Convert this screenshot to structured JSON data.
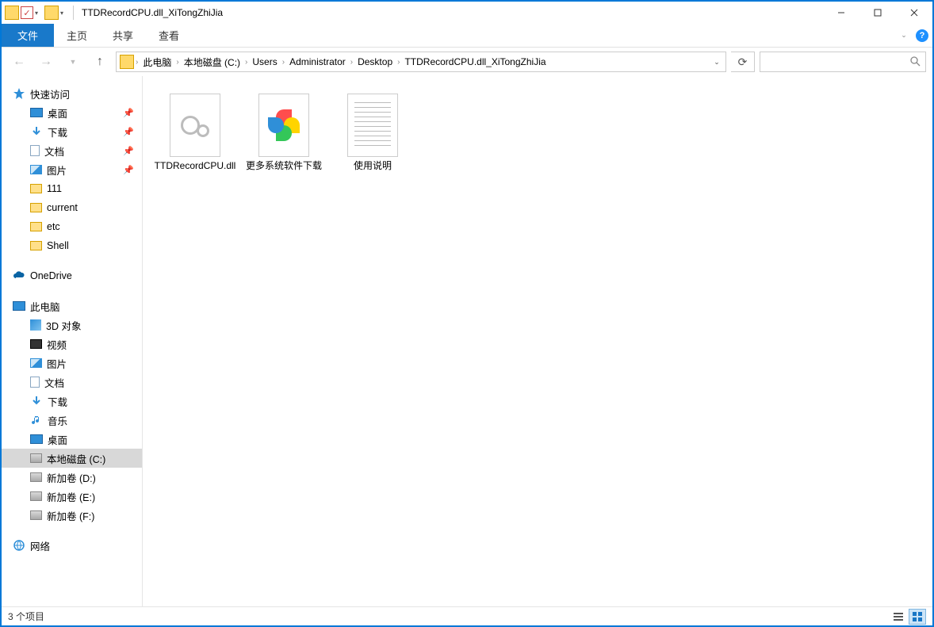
{
  "title": "TTDRecordCPU.dll_XiTongZhiJia",
  "ribbon": {
    "file": "文件",
    "tabs": [
      "主页",
      "共享",
      "查看"
    ]
  },
  "breadcrumb": [
    "此电脑",
    "本地磁盘 (C:)",
    "Users",
    "Administrator",
    "Desktop",
    "TTDRecordCPU.dll_XiTongZhiJia"
  ],
  "search_placeholder": "",
  "nav": {
    "quick_access": "快速访问",
    "quick_items": [
      {
        "label": "桌面",
        "icon": "monitor",
        "pinned": true
      },
      {
        "label": "下载",
        "icon": "arrowdown",
        "pinned": true
      },
      {
        "label": "文档",
        "icon": "doc",
        "pinned": true
      },
      {
        "label": "图片",
        "icon": "pic",
        "pinned": true
      },
      {
        "label": "111",
        "icon": "folder",
        "pinned": false
      },
      {
        "label": "current",
        "icon": "folder",
        "pinned": false
      },
      {
        "label": "etc",
        "icon": "folder",
        "pinned": false
      },
      {
        "label": "Shell",
        "icon": "folder",
        "pinned": false
      }
    ],
    "onedrive": "OneDrive",
    "this_pc": "此电脑",
    "pc_items": [
      {
        "label": "3D 对象",
        "icon": "d3d"
      },
      {
        "label": "视频",
        "icon": "video"
      },
      {
        "label": "图片",
        "icon": "pic"
      },
      {
        "label": "文档",
        "icon": "doc"
      },
      {
        "label": "下载",
        "icon": "arrowdown"
      },
      {
        "label": "音乐",
        "icon": "music"
      },
      {
        "label": "桌面",
        "icon": "monitor"
      },
      {
        "label": "本地磁盘 (C:)",
        "icon": "disk",
        "selected": true
      },
      {
        "label": "新加卷 (D:)",
        "icon": "disk"
      },
      {
        "label": "新加卷 (E:)",
        "icon": "disk"
      },
      {
        "label": "新加卷 (F:)",
        "icon": "disk"
      }
    ],
    "network": "网络"
  },
  "files": [
    {
      "label": "TTDRecordCPU.dll",
      "kind": "dll"
    },
    {
      "label": "更多系统软件下载",
      "kind": "url"
    },
    {
      "label": "使用说明",
      "kind": "txt"
    }
  ],
  "status": "3 个项目"
}
